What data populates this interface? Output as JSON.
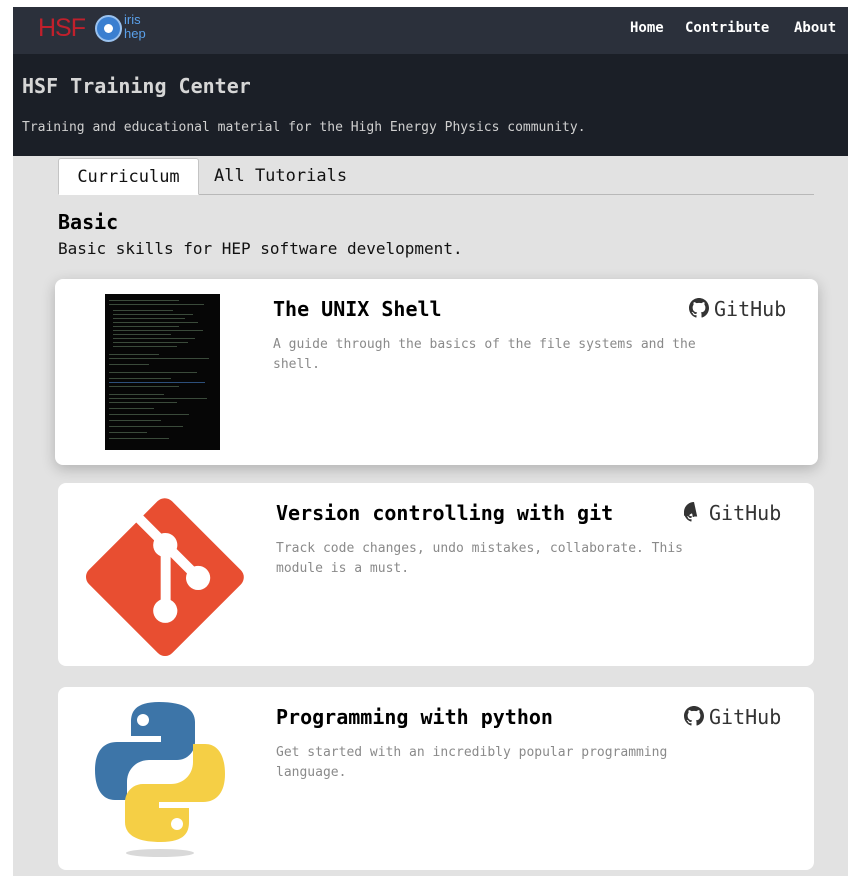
{
  "nav": {
    "logo_hsf": "HSF",
    "logo_iris_top": "iris",
    "logo_iris_bottom": "hep",
    "links": [
      "Home",
      "Contribute",
      "About"
    ]
  },
  "header": {
    "title": "HSF Training Center",
    "subtitle": "Training and educational material for the High Energy Physics community."
  },
  "tabs": [
    "Curriculum",
    "All Tutorials"
  ],
  "active_tab": "Curriculum",
  "section": {
    "title": "Basic",
    "subtitle": "Basic skills for HEP software development."
  },
  "cards": [
    {
      "title": "The UNIX Shell",
      "description": "A guide through the basics of the file systems and the shell.",
      "link_label": "GitHub",
      "image_icon": "terminal-screenshot"
    },
    {
      "title": "Version controlling with git",
      "description": "Track code changes, undo mistakes, collaborate. This module is a must.",
      "link_label": "GitHub",
      "image_icon": "git-logo"
    },
    {
      "title": "Programming with python",
      "description": "Get started with an incredibly popular programming language.",
      "link_label": "GitHub",
      "image_icon": "python-logo"
    }
  ],
  "colors": {
    "nav_bg": "#2b303b",
    "header_bg": "#1b1f27",
    "page_bg": "#e2e2e2",
    "git_red": "#e84e31",
    "python_blue": "#3d75a8",
    "python_yellow": "#f5cf45"
  }
}
